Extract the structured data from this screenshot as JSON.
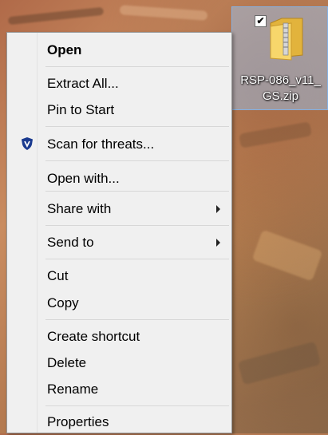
{
  "desktop": {
    "file": {
      "name_line1": "RSP-086_v11_",
      "name_line2": "GS.zip",
      "checked_mark": "✔",
      "icon": "zip-folder-icon"
    }
  },
  "context_menu": {
    "items": [
      {
        "label": "Open",
        "bold": true
      },
      {
        "label": "Extract All..."
      },
      {
        "label": "Pin to Start"
      },
      {
        "label": "Scan for threats...",
        "icon": "shield-icon",
        "icon_color": "#1a3a8f"
      },
      {
        "label": "Open with..."
      },
      {
        "label": "Share with",
        "submenu": true
      },
      {
        "label": "Send to",
        "submenu": true
      },
      {
        "label": "Cut"
      },
      {
        "label": "Copy"
      },
      {
        "label": "Create shortcut"
      },
      {
        "label": "Delete"
      },
      {
        "label": "Rename"
      },
      {
        "label": "Properties"
      }
    ]
  }
}
